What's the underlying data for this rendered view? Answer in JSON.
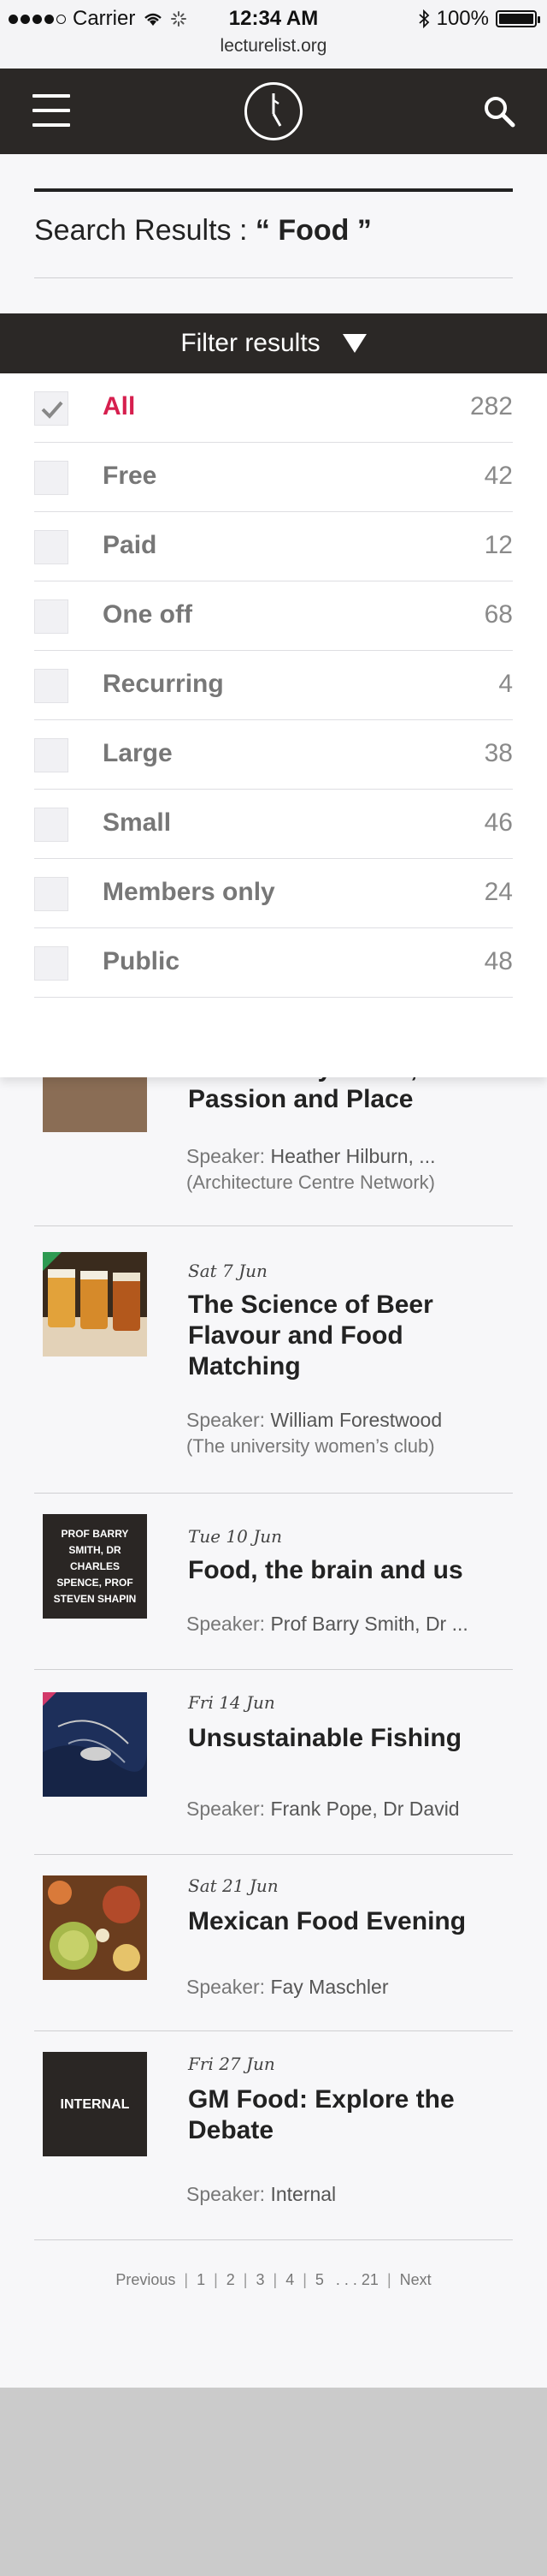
{
  "status_bar": {
    "carrier": "Carrier",
    "time": "12:34 AM",
    "battery": "100%",
    "battery_level": 1.0,
    "url": "lecturelist.org"
  },
  "header": {
    "menu_icon": "hamburger-icon",
    "logo_icon": "clock-logo-icon",
    "search_icon": "search-icon",
    "background": "#2b2826"
  },
  "search": {
    "prefix": "Search Results : ",
    "query": "“ Food ”"
  },
  "filter_bar": {
    "label": "Filter results",
    "icon": "triangle-down-icon"
  },
  "filters": [
    {
      "label": "All",
      "count": "282",
      "checked": true
    },
    {
      "label": "Free",
      "count": "42",
      "checked": false
    },
    {
      "label": "Paid",
      "count": "12",
      "checked": false
    },
    {
      "label": "One off",
      "count": "68",
      "checked": false
    },
    {
      "label": "Recurring",
      "count": "4",
      "checked": false
    },
    {
      "label": "Large",
      "count": "38",
      "checked": false
    },
    {
      "label": "Small",
      "count": "46",
      "checked": false
    },
    {
      "label": "Members only",
      "count": "24",
      "checked": false
    },
    {
      "label": "Public",
      "count": "48",
      "checked": false
    }
  ],
  "accent_color": "#d61f4e",
  "results": [
    {
      "date": "",
      "title": "Hands Dirty: Food, Passion and Place",
      "speaker_label": "Speaker: ",
      "speaker": "Heather Hilburn, ...",
      "org": "(Architecture Centre Network)",
      "thumb_text": ""
    },
    {
      "date": "Sat 7 Jun",
      "title": "The Science of Beer Flavour and Food Matching",
      "speaker_label": "Speaker: ",
      "speaker": "William Forestwood",
      "org": "(The university women’s club)",
      "thumb_text": ""
    },
    {
      "date": "Tue 10 Jun",
      "title": "Food, the brain and us",
      "speaker_label": "Speaker: ",
      "speaker": "Prof Barry Smith, Dr ...",
      "org": "",
      "thumb_text": "PROF BARRY SMITH, DR CHARLES SPENCE, PROF STEVEN SHAPIN"
    },
    {
      "date": "Fri 14 Jun",
      "title": "Unsustainable Fishing",
      "speaker_label": "Speaker: ",
      "speaker": "Frank Pope, Dr David",
      "org": "",
      "thumb_text": ""
    },
    {
      "date": "Sat 21 Jun",
      "title": "Mexican Food Evening",
      "speaker_label": "Speaker: ",
      "speaker": "Fay Maschler",
      "org": "",
      "thumb_text": ""
    },
    {
      "date": "Fri 27 Jun",
      "title": "GM Food: Explore the Debate",
      "speaker_label": "Speaker: ",
      "speaker": "Internal",
      "org": "",
      "thumb_text": "INTERNAL"
    }
  ],
  "pagination": {
    "previous": "Previous",
    "pages": [
      "1",
      "2",
      "3",
      "4",
      "5"
    ],
    "ellipsis": ". . . 21",
    "next": "Next"
  }
}
